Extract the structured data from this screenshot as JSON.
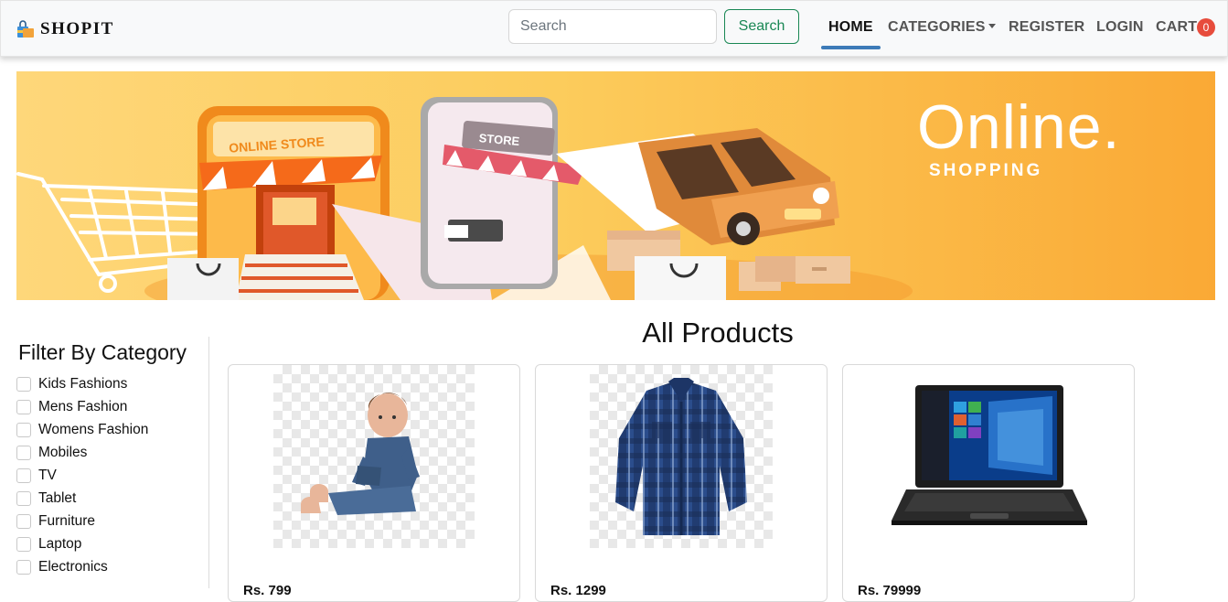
{
  "navbar": {
    "brand": "SHOPIT",
    "brand_icon": "shopping-bag-icon",
    "search": {
      "placeholder": "Search",
      "value": ""
    },
    "search_button": "Search",
    "links": {
      "home": "HOME",
      "categories": "CATEGORIES",
      "register": "REGISTER",
      "login": "LOGIN",
      "cart": "CART"
    },
    "cart_count": "0",
    "active_link": "home"
  },
  "banner": {
    "title": "Online.",
    "subtitle": "SHOPPING",
    "store_sign": "ONLINE STORE",
    "phone_sign": "STORE"
  },
  "sidebar": {
    "title": "Filter By Category",
    "categories": [
      {
        "label": "Kids Fashions",
        "checked": false
      },
      {
        "label": "Mens Fashion",
        "checked": false
      },
      {
        "label": "Womens Fashion",
        "checked": false
      },
      {
        "label": "Mobiles",
        "checked": false
      },
      {
        "label": "TV",
        "checked": false
      },
      {
        "label": "Tablet",
        "checked": false
      },
      {
        "label": "Furniture",
        "checked": false
      },
      {
        "label": "Laptop",
        "checked": false
      },
      {
        "label": "Electronics",
        "checked": false
      }
    ]
  },
  "main": {
    "title": "All Products",
    "products": [
      {
        "image": "baby-denim-outfit",
        "price": "Rs. 799"
      },
      {
        "image": "blue-checked-shirt",
        "price": "Rs. 1299"
      },
      {
        "image": "black-laptop",
        "price": "Rs. 79999"
      }
    ]
  },
  "colors": {
    "accent": "#198754",
    "active_underline": "#3d7bb8",
    "badge": "#e74c3c",
    "banner": "#fccc5c"
  }
}
